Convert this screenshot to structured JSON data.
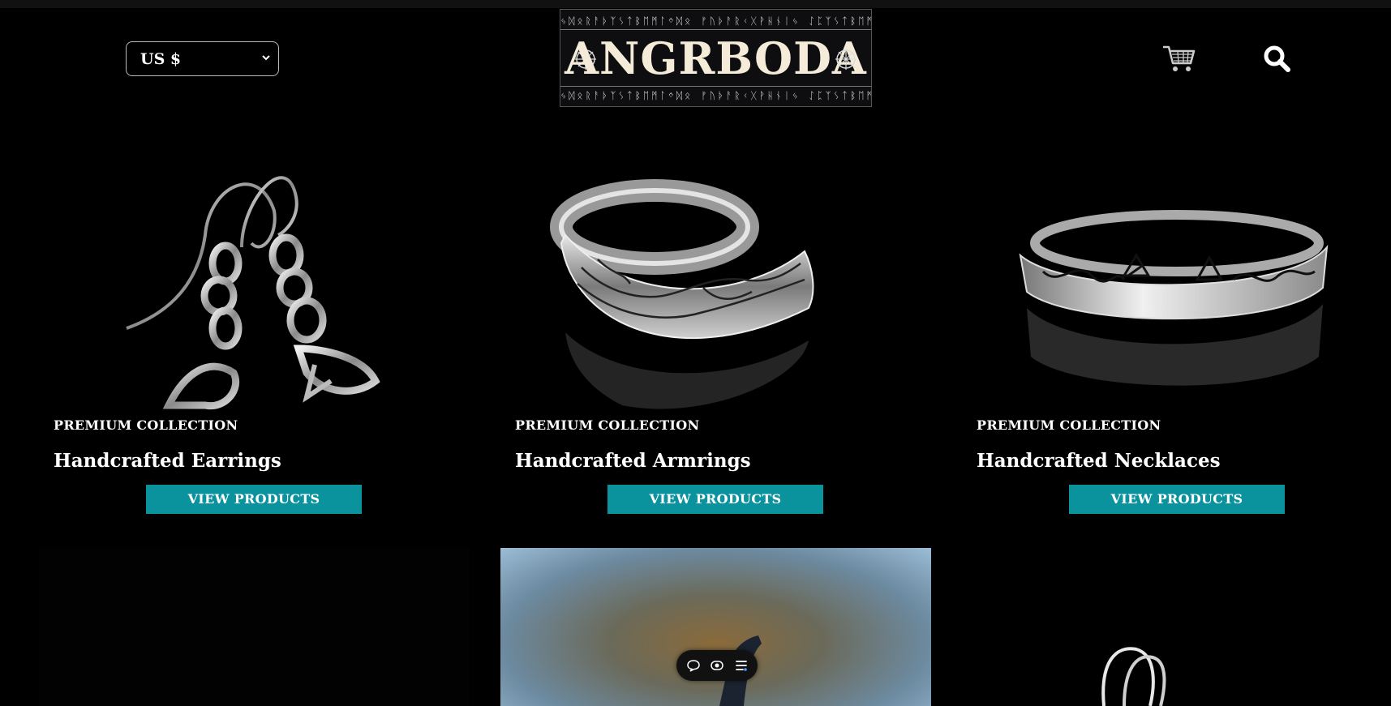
{
  "header": {
    "currency_value": "US $",
    "logo_text": "ANGRBODA",
    "logo_runes": "ᛃᛞᛟᚱᚨᚦᛉᛊᛏᛒᛖᛗᛚᛜᛞᛟ ᚠᚢᚦᚨᚱᚲᚷᚹᚺᚾᛁᛃ ᛇᛈᛉᛊᛏᛒᛖᛗᛚᛜᛞᛟ",
    "cart_icon": "shopping-cart-icon",
    "search_icon": "search-icon"
  },
  "products": [
    {
      "label": "PREMIUM COLLECTION",
      "title": "Handcrafted Earrings",
      "button": "VIEW PRODUCTS"
    },
    {
      "label": "PREMIUM COLLECTION",
      "title": "Handcrafted Armrings",
      "button": "VIEW PRODUCTS"
    },
    {
      "label": "PREMIUM COLLECTION",
      "title": "Handcrafted Necklaces",
      "button": "VIEW PRODUCTS"
    }
  ],
  "colors": {
    "background": "#000000",
    "button": "#0a929d",
    "logo_text": "#f4ecd8"
  },
  "toolbar": {
    "icons": [
      "chat-icon",
      "eye-toggle-icon",
      "menu-list-icon"
    ]
  }
}
